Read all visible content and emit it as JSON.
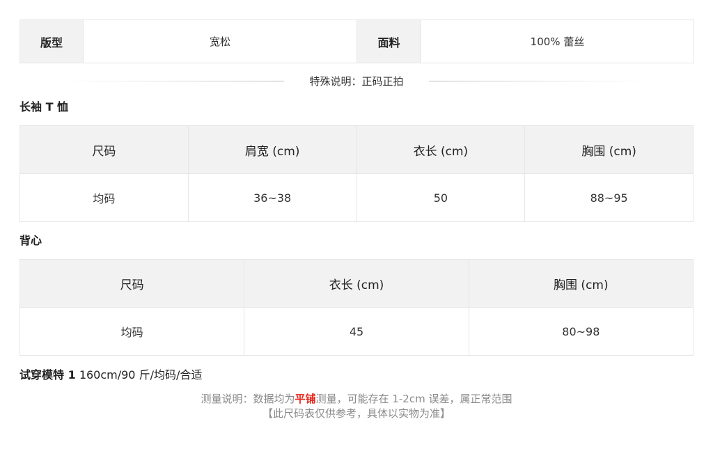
{
  "attributes": {
    "fit_label": "版型",
    "fit_value": "宽松",
    "fabric_label": "面料",
    "fabric_value": "100% 蕾丝"
  },
  "special_note": "特殊说明：正码正拍",
  "tshirt": {
    "title": "长袖 T 恤",
    "headers": [
      "尺码",
      "肩宽 (cm)",
      "衣长 (cm)",
      "胸围 (cm)"
    ],
    "row": [
      "均码",
      "36~38",
      "50",
      "88~95"
    ]
  },
  "vest": {
    "title": "背心",
    "headers": [
      "尺码",
      "衣长 (cm)",
      "胸围 (cm)"
    ],
    "row": [
      "均码",
      "45",
      "80~98"
    ]
  },
  "model": {
    "label": "试穿模特 1",
    "info": "160cm/90 斤/均码/合适"
  },
  "measure_note": {
    "prefix": "测量说明：数据均为",
    "highlight": "平铺",
    "suffix": "测量，可能存在 1-2cm 误差，属正常范围",
    "line2": "【此尺码表仅供参考，具体以实物为准】",
    "highlight_color": "#e5271d"
  }
}
